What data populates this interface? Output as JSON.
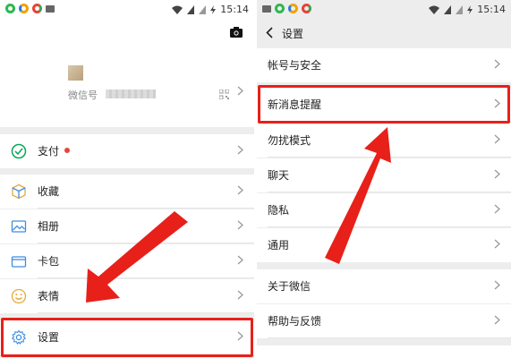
{
  "status_bar": {
    "time": "15:14"
  },
  "left_screen": {
    "profile": {
      "wechat_id_label": "微信号"
    },
    "menu": [
      {
        "key": "pay",
        "label": "支付",
        "icon": "wallet-check-icon"
      },
      {
        "key": "favorites",
        "label": "收藏",
        "icon": "cube-icon"
      },
      {
        "key": "album",
        "label": "相册",
        "icon": "image-icon"
      },
      {
        "key": "cards",
        "label": "卡包",
        "icon": "card-icon"
      },
      {
        "key": "stickers",
        "label": "表情",
        "icon": "smiley-icon"
      },
      {
        "key": "settings",
        "label": "设置",
        "icon": "gear-icon"
      }
    ]
  },
  "right_screen": {
    "nav_title": "设置",
    "menu": [
      {
        "key": "account",
        "label": "帐号与安全"
      },
      {
        "key": "notifications",
        "label": "新消息提醒"
      },
      {
        "key": "dnd",
        "label": "勿扰模式"
      },
      {
        "key": "chat",
        "label": "聊天"
      },
      {
        "key": "privacy",
        "label": "隐私"
      },
      {
        "key": "general",
        "label": "通用"
      },
      {
        "key": "about",
        "label": "关于微信"
      },
      {
        "key": "help",
        "label": "帮助与反馈"
      }
    ]
  },
  "colors": {
    "highlight": "#e8201a",
    "wechat_green": "#07c160",
    "background": "#ededed"
  }
}
